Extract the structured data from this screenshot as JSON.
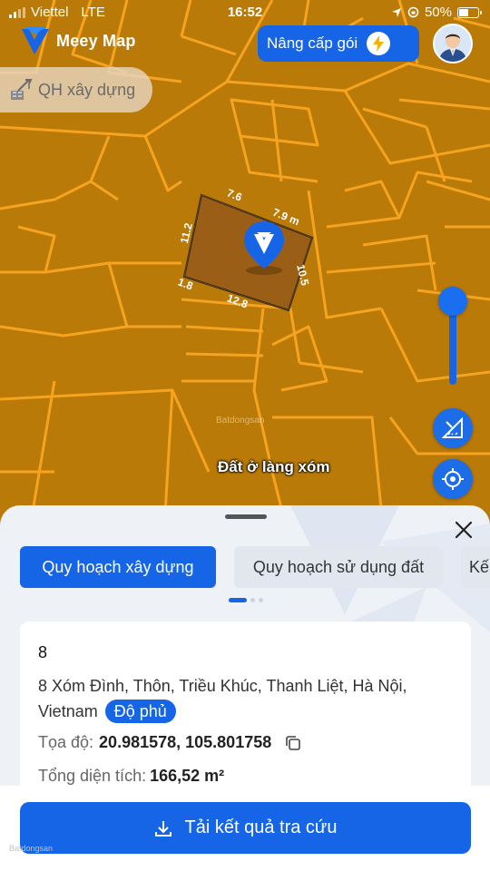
{
  "status_bar": {
    "carrier": "Viettel",
    "network": "LTE",
    "time": "16:52",
    "battery": "50%",
    "battery_level": 0.5
  },
  "header": {
    "brand": "Meey Map",
    "upgrade_label": "Nâng cấp gói"
  },
  "map": {
    "layer_pill": "QH xây dựng",
    "zone_label": "Đất ở làng xóm",
    "watermark": "Batdongsan",
    "dimensions": {
      "top": "7.6",
      "top_right": "7.9 m",
      "right": "10.5",
      "left": "11.2",
      "bottom_left": "1.8",
      "bottom": "12.8"
    }
  },
  "sheet": {
    "tabs": [
      {
        "label": "Quy hoạch xây dựng",
        "active": true
      },
      {
        "label": "Quy hoạch sử dụng đất",
        "active": false
      },
      {
        "label": "Kế",
        "active": false
      }
    ],
    "card": {
      "number": "8",
      "address": "8 Xóm Đình, Thôn, Triều Khúc, Thanh Liệt, Hà Nội, Vietnam",
      "coverage_badge": "Độ phủ",
      "coord_label": "Tọa độ:",
      "coord_value": "20.981578, 105.801758",
      "area_label": "Tổng diện tích:",
      "area_value": "166,52 m²"
    }
  },
  "actions": {
    "download_label": "Tải kết quả tra cứu",
    "watermark": "Batdongsan"
  },
  "colors": {
    "map_fill": "#b97a08",
    "parcel_line": "#f5a623",
    "accent": "#1565e6"
  }
}
